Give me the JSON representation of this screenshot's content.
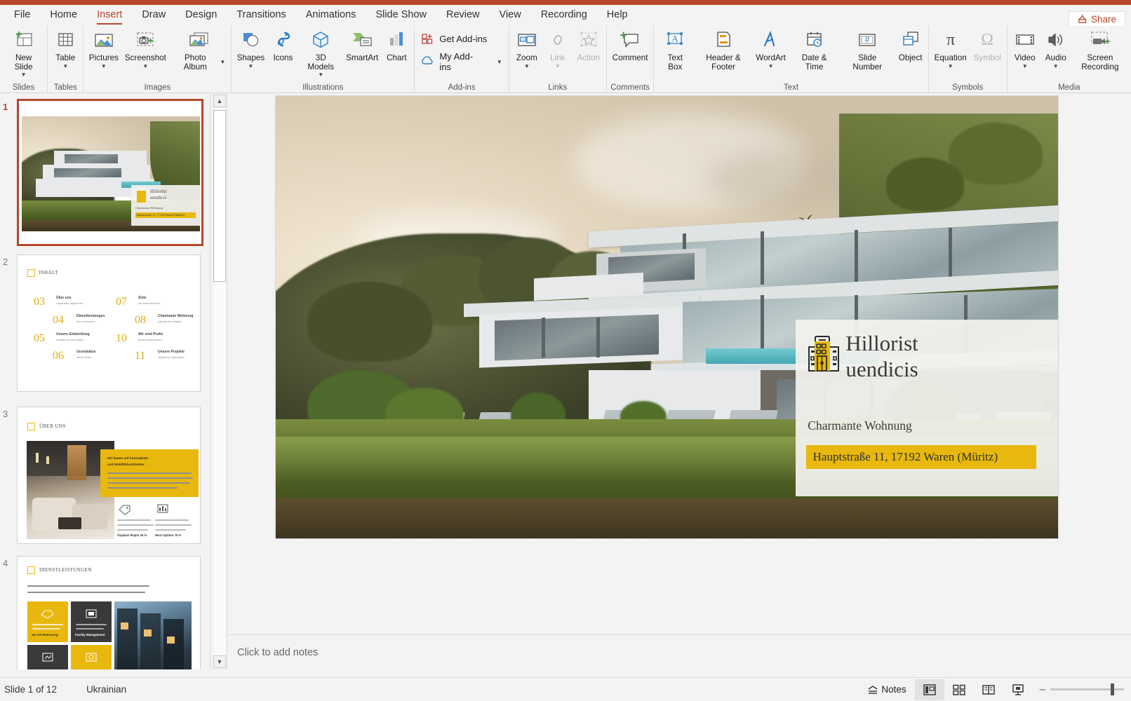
{
  "window": {
    "share_label": "Share",
    "accent_color": "#b7472a"
  },
  "tabs": [
    {
      "label": "File",
      "active": false
    },
    {
      "label": "Home",
      "active": false
    },
    {
      "label": "Insert",
      "active": true
    },
    {
      "label": "Draw",
      "active": false
    },
    {
      "label": "Design",
      "active": false
    },
    {
      "label": "Transitions",
      "active": false
    },
    {
      "label": "Animations",
      "active": false
    },
    {
      "label": "Slide Show",
      "active": false
    },
    {
      "label": "Review",
      "active": false
    },
    {
      "label": "View",
      "active": false
    },
    {
      "label": "Recording",
      "active": false
    },
    {
      "label": "Help",
      "active": false
    }
  ],
  "ribbon": {
    "groups": [
      {
        "name": "Slides",
        "label": "Slides",
        "buttons": [
          {
            "label": "New Slide",
            "icon": "new-slide-icon",
            "caret": true,
            "disabled": false
          }
        ]
      },
      {
        "name": "Tables",
        "label": "Tables",
        "buttons": [
          {
            "label": "Table",
            "icon": "table-icon",
            "caret": true,
            "disabled": false
          }
        ]
      },
      {
        "name": "Images",
        "label": "Images",
        "buttons": [
          {
            "label": "Pictures",
            "icon": "pictures-icon",
            "caret": true,
            "disabled": false
          },
          {
            "label": "Screenshot",
            "icon": "screenshot-icon",
            "caret": true,
            "disabled": false
          },
          {
            "label": "Photo Album",
            "icon": "photo-album-icon",
            "caret": true,
            "disabled": false
          }
        ]
      },
      {
        "name": "Illustrations",
        "label": "Illustrations",
        "buttons": [
          {
            "label": "Shapes",
            "icon": "shapes-icon",
            "caret": true,
            "disabled": false
          },
          {
            "label": "Icons",
            "icon": "icons-icon",
            "caret": false,
            "disabled": false
          },
          {
            "label": "3D Models",
            "icon": "3d-models-icon",
            "caret": true,
            "disabled": false
          },
          {
            "label": "SmartArt",
            "icon": "smartart-icon",
            "caret": false,
            "disabled": false
          },
          {
            "label": "Chart",
            "icon": "chart-icon",
            "caret": false,
            "disabled": false
          }
        ]
      },
      {
        "name": "Add-ins",
        "label": "Add-ins",
        "buttons": [
          {
            "label": "Get Add-ins",
            "icon": "get-addins-icon",
            "caret": false,
            "disabled": false
          },
          {
            "label": "My Add-ins",
            "icon": "my-addins-icon",
            "caret": true,
            "disabled": false
          }
        ]
      },
      {
        "name": "Links",
        "label": "Links",
        "buttons": [
          {
            "label": "Zoom",
            "icon": "zoom-icon",
            "caret": true,
            "disabled": false
          },
          {
            "label": "Link",
            "icon": "link-icon",
            "caret": true,
            "disabled": true
          },
          {
            "label": "Action",
            "icon": "action-icon",
            "caret": false,
            "disabled": true
          }
        ]
      },
      {
        "name": "Comments",
        "label": "Comments",
        "buttons": [
          {
            "label": "Comment",
            "icon": "comment-icon",
            "caret": false,
            "disabled": false
          }
        ]
      },
      {
        "name": "Text",
        "label": "Text",
        "buttons": [
          {
            "label": "Text Box",
            "icon": "text-box-icon",
            "caret": false,
            "disabled": false
          },
          {
            "label": "Header & Footer",
            "icon": "header-footer-icon",
            "caret": false,
            "disabled": false
          },
          {
            "label": "WordArt",
            "icon": "wordart-icon",
            "caret": true,
            "disabled": false
          },
          {
            "label": "Date & Time",
            "icon": "date-time-icon",
            "caret": false,
            "disabled": false
          },
          {
            "label": "Slide Number",
            "icon": "slide-number-icon",
            "caret": false,
            "disabled": false
          },
          {
            "label": "Object",
            "icon": "object-icon",
            "caret": false,
            "disabled": false
          }
        ]
      },
      {
        "name": "Symbols",
        "label": "Symbols",
        "buttons": [
          {
            "label": "Equation",
            "icon": "equation-icon",
            "caret": true,
            "disabled": false
          },
          {
            "label": "Symbol",
            "icon": "symbol-icon",
            "caret": false,
            "disabled": true
          }
        ]
      },
      {
        "name": "Media",
        "label": "Media",
        "buttons": [
          {
            "label": "Video",
            "icon": "video-icon",
            "caret": true,
            "disabled": false
          },
          {
            "label": "Audio",
            "icon": "audio-icon",
            "caret": true,
            "disabled": false
          },
          {
            "label": "Screen Recording",
            "icon": "screen-recording-icon",
            "caret": false,
            "disabled": false
          }
        ]
      }
    ]
  },
  "thumbnails": [
    {
      "number": "1",
      "selected": true,
      "title": ""
    },
    {
      "number": "2",
      "selected": false,
      "title": "INHALT"
    },
    {
      "number": "3",
      "selected": false,
      "title": "ÜBER UNS"
    },
    {
      "number": "4",
      "selected": false,
      "title": "DIENSTLEISTUNGEN"
    }
  ],
  "slide2": {
    "heading": "INHALT",
    "entries": [
      {
        "num": "03",
        "title": "Über uns",
        "desc": "Ligula tellus magna erat ..."
      },
      {
        "num": "04",
        "title": "Dienstleistungen",
        "desc": "Arbo orrewocum ..."
      },
      {
        "num": "05",
        "title": "Unsere Entwicklung",
        "desc": "Obstklar mit vons baffen ..."
      },
      {
        "num": "06",
        "title": "Grundsätze",
        "desc": "werein detail ..."
      },
      {
        "num": "07",
        "title": "Ziele",
        "desc": "des Unternehmens ..."
      },
      {
        "num": "08",
        "title": "Charmante Wohnung",
        "desc": "Ultracko ist umbkatio ..."
      },
      {
        "num": "10",
        "title": "Wir sind Profis",
        "desc": "Neuse sollsel adicas ..."
      },
      {
        "num": "11",
        "title": "Unsere Projekte",
        "desc": "Magaanrito Naturquam ..."
      }
    ]
  },
  "slide3": {
    "heading": "ÜBER UNS",
    "callout_line1": "Wir bauen auf Atmosphäre",
    "callout_line2": "und Wohlfühlarchitektur",
    "stat1": "Ouplaue Rupta 25 %",
    "stat2": "Mosi Uptime 75 %"
  },
  "slide4": {
    "heading": "DIENSTLEISTUNGEN",
    "card1": "Vor-Ort-Betreuung",
    "card2": "Facility Management"
  },
  "slide": {
    "card": {
      "title_line1": "Hillorist",
      "title_line2": "uendicis",
      "subtitle": "Charmante Wohnung",
      "address": "Hauptstraße 11, 17192 Waren (Müritz)",
      "logo_icon": "apartment-building-icon",
      "accent_color": "#e8b80e"
    }
  },
  "notes": {
    "placeholder": "Click to add notes"
  },
  "status": {
    "slide_counter": "Slide 1 of 12",
    "language": "Ukrainian",
    "notes_label": "Notes",
    "views": [
      {
        "name": "normal-view",
        "active": true
      },
      {
        "name": "slide-sorter-view",
        "active": false
      },
      {
        "name": "reading-view",
        "active": false
      },
      {
        "name": "slide-show-view",
        "active": false
      }
    ],
    "zoom_minus": "–",
    "zoom_plus": ""
  }
}
